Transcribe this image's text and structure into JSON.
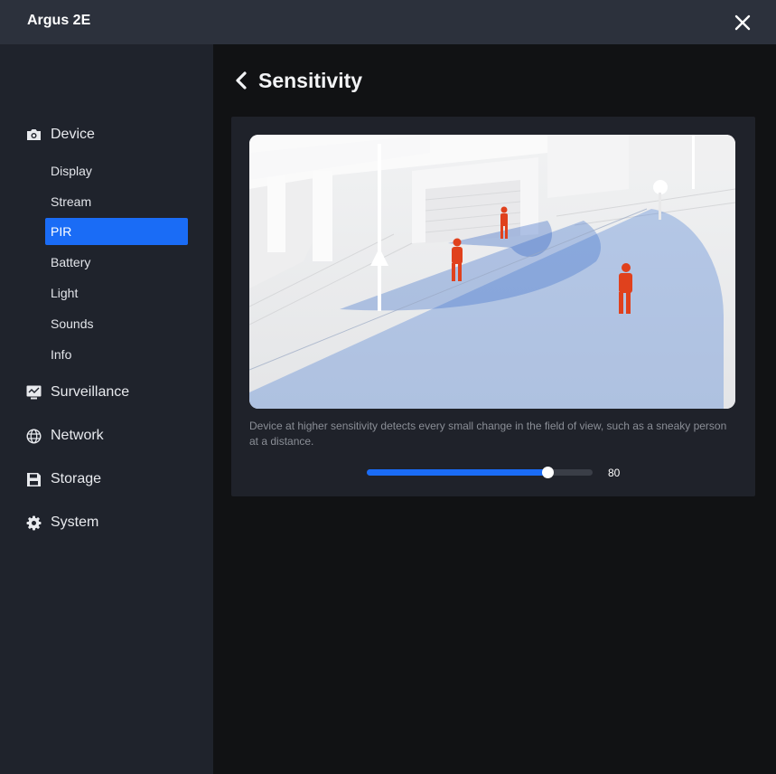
{
  "window": {
    "title": "Argus 2E"
  },
  "sidebar": {
    "groups": [
      {
        "label": "Device",
        "icon": "camera-icon"
      },
      {
        "label": "Surveillance",
        "icon": "monitor-icon"
      },
      {
        "label": "Network",
        "icon": "globe-icon"
      },
      {
        "label": "Storage",
        "icon": "floppy-icon"
      },
      {
        "label": "System",
        "icon": "gear-icon"
      }
    ],
    "device_items": [
      {
        "label": "Display"
      },
      {
        "label": "Stream"
      },
      {
        "label": "PIR",
        "active": true
      },
      {
        "label": "Battery"
      },
      {
        "label": "Light"
      },
      {
        "label": "Sounds"
      },
      {
        "label": "Info"
      }
    ]
  },
  "main": {
    "title": "Sensitivity",
    "description": "Device at higher sensitivity detects every small change in the field of view, such as a sneaky person at a distance.",
    "slider": {
      "value": "80",
      "min": 0,
      "max": 100
    }
  },
  "colors": {
    "accent": "#1a6cf6",
    "sidebar": "#1f232c",
    "titlebar": "#2c313c",
    "person": "#e0411d"
  }
}
